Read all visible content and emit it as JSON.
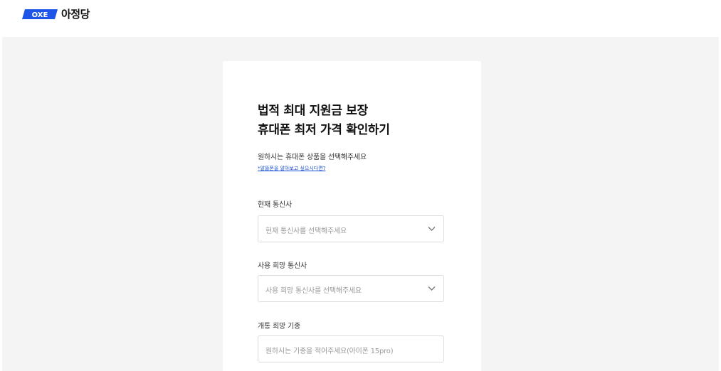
{
  "header": {
    "logo_mark_text": "OXE",
    "logo_text": "아정당",
    "brand_color": "#1d55e6"
  },
  "form": {
    "title_line1": "법적 최대 지원금 보장",
    "title_line2": "휴대폰 최저 가격 확인하기",
    "subtitle": "원하시는 휴대폰 상품을 선택해주세요",
    "help_link": "*알뜰폰을 알아보고 싶으시다면?",
    "fields": [
      {
        "label": "현재 통신사",
        "placeholder": "현재 통신사를 선택해주세요",
        "type": "select",
        "icon": "chevron-down-icon"
      },
      {
        "label": "사용 희망 통신사",
        "placeholder": "사용 희망 통신사를 선택해주세요",
        "type": "select",
        "icon": "chevron-down-icon"
      },
      {
        "label": "개통 희망 기종",
        "placeholder": "원하시는 기종을 적어주세요(아이폰 15pro)",
        "type": "text"
      }
    ]
  }
}
